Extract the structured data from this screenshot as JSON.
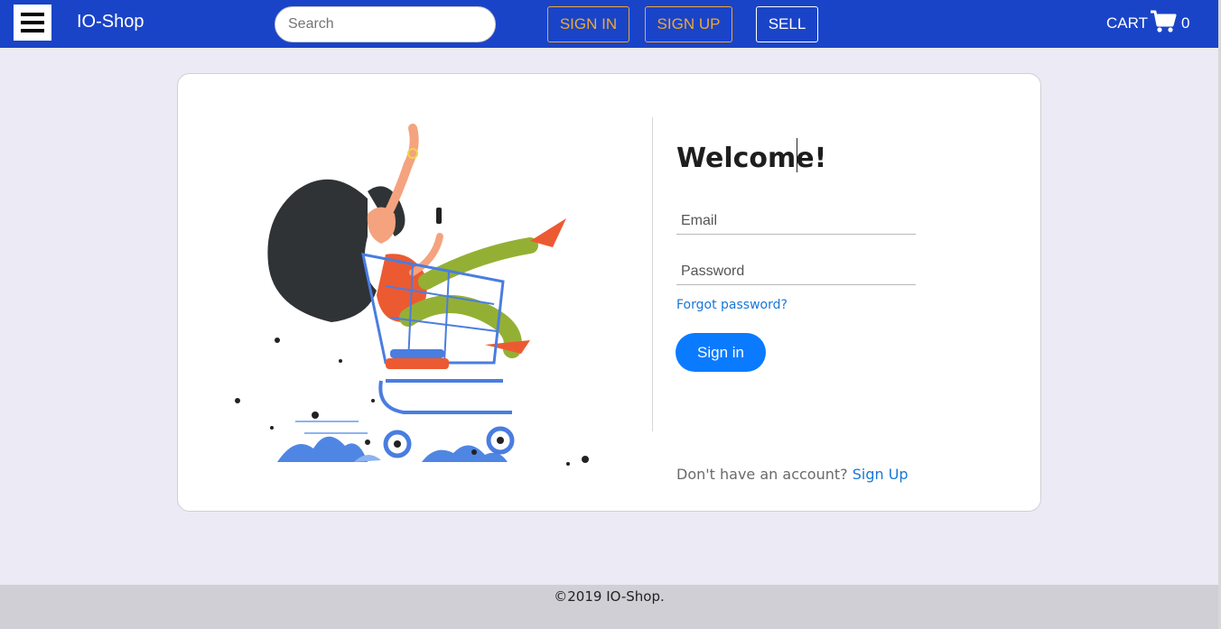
{
  "navbar": {
    "brand": "IO-Shop",
    "search_placeholder": "Search",
    "sign_in_label": "SIGN IN",
    "sign_up_label": "SIGN UP",
    "sell_label": "SELL",
    "cart_label": "CART",
    "cart_count": "0",
    "menu_icon": "hamburger-icon",
    "cart_icon": "shopping-cart-icon"
  },
  "login": {
    "heading": "Welcome!",
    "email_placeholder": "Email",
    "password_placeholder": "Password",
    "forgot_label": "Forgot password?",
    "submit_label": "Sign in",
    "no_account_text": "Don't have an account?",
    "signup_link": "Sign Up",
    "illustration": "woman-in-shopping-cart-illustration"
  },
  "footer": {
    "copyright": "©2019 IO-Shop."
  },
  "colors": {
    "navbar_bg": "#1a44c8",
    "accent_orange": "#f0a830",
    "primary_button": "#0a7bff",
    "link": "#1877d8",
    "page_bg": "#ebeaf5",
    "footer_bg": "#d0cfd6"
  }
}
